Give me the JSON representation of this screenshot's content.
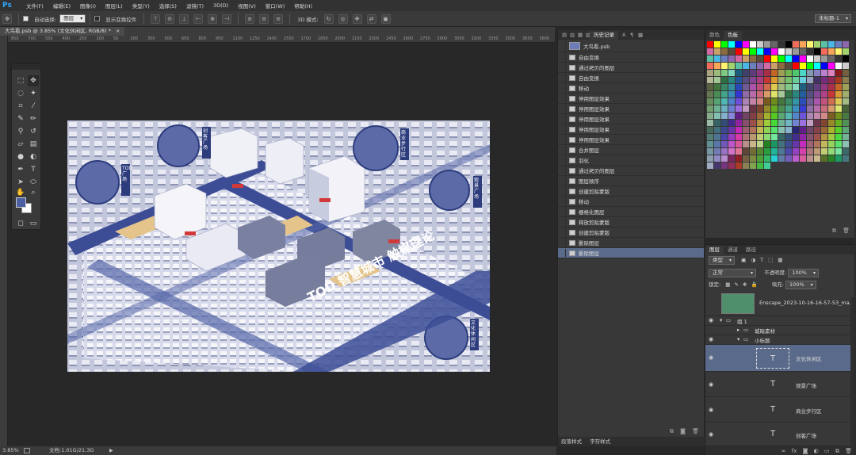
{
  "app": {
    "logo": "Ps",
    "menus": [
      "文件(F)",
      "编辑(E)",
      "图像(I)",
      "图层(L)",
      "类型(Y)",
      "选择(S)",
      "滤镜(T)",
      "3D(D)",
      "视图(V)",
      "窗口(W)",
      "帮助(H)"
    ]
  },
  "options_bar": {
    "auto_select_label": "自动选择:",
    "auto_select_value": "图层",
    "show_transform_label": "显示变换控件",
    "mode_3d_label": "3D 模式:",
    "workspace_value": "未标题-1"
  },
  "document": {
    "tab_title": "大鸟看.psb @ 3.85% (文化休闲区, RGB/8) *",
    "tab_close": "×",
    "zoom": "3.85%",
    "doc_size": "文档:1.01G/21.3G"
  },
  "ruler_ticks": [
    "850",
    "700",
    "550",
    "400",
    "250",
    "100",
    "50",
    "200",
    "350",
    "500",
    "650",
    "800",
    "950",
    "1100",
    "1250",
    "1400",
    "1550",
    "1700",
    "1850",
    "2000",
    "2150",
    "2300",
    "2450",
    "2600",
    "2750",
    "2900",
    "3050",
    "3200",
    "3350",
    "3500",
    "3650",
    "3800"
  ],
  "image_text": {
    "title_cn": "TOD 智慧城市 触媒理论",
    "title_en": "TOD S.SMART CITY&CATALYST THEORY",
    "callout_left": "TOD广场",
    "callout_topleft": "创客广场",
    "callout_top": "商业步行区",
    "callout_right": "观景广场",
    "callout_bottomright": "文化休闲区"
  },
  "history": {
    "tabs": [
      "历史记录"
    ],
    "snapshot": "大鸟看.psb",
    "items": [
      "自由变换",
      "通过拷贝的图层",
      "自由变换",
      "移动",
      "停用图层效果",
      "停用图层效果",
      "停用图层效果",
      "停用图层效果",
      "停用图层效果",
      "合并图层",
      "羽化",
      "通过拷贝的图层",
      "图层顺序",
      "创建剪贴蒙版",
      "移动",
      "栅格化图层",
      "释放剪贴蒙版",
      "创建剪贴蒙版",
      "删除图层",
      "删除图层"
    ],
    "tab_bottom": [
      "段落样式",
      "字符样式"
    ]
  },
  "swatches": {
    "tabs": [
      "颜色",
      "色板"
    ]
  },
  "layers": {
    "tabs": [
      "图层",
      "通道",
      "路径"
    ],
    "filter_label": "类型",
    "blend_mode": "正常",
    "opacity_label": "不透明度:",
    "opacity_value": "100%",
    "lock_label": "锁定:",
    "fill_label": "填充:",
    "fill_value": "100%",
    "top_layer_name": "Enscape_2023-10-16-16-57-53_ma...",
    "group1": "组 1",
    "group_sub1": "城暗素材",
    "group_sub2": "小标题",
    "text_layers": [
      "文化休闲区",
      "观景广场",
      "商业步行区",
      "创客广场"
    ]
  },
  "colors": {
    "accent": "#31a8ff",
    "panel_bg": "#383838",
    "selection": "#5a6a8a",
    "fg_color": "#4a5fa4",
    "bg_color": "#ffffff",
    "image_base": "#b4b9d2",
    "image_dark": "#3c4d96"
  }
}
